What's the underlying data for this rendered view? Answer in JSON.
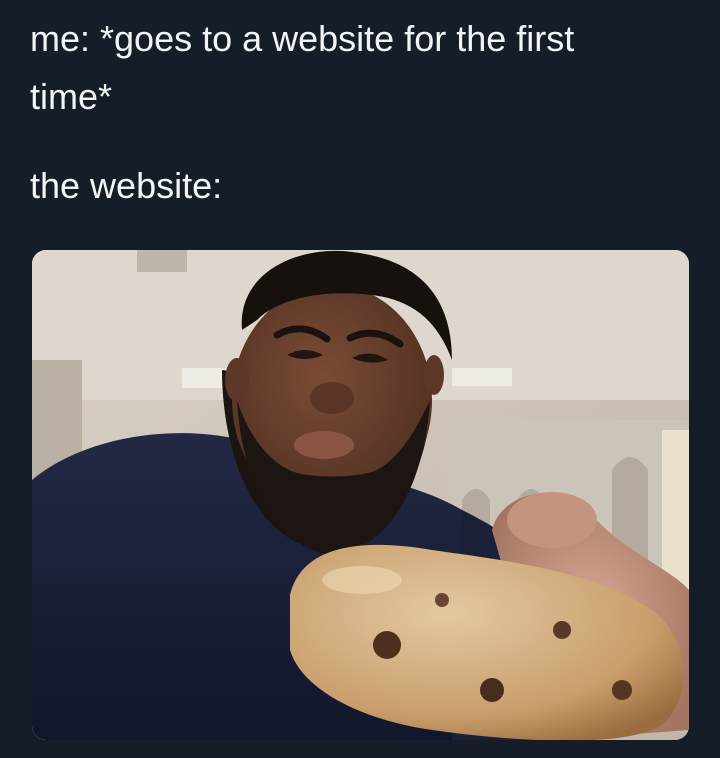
{
  "post": {
    "caption_line_1": "me: *goes to a website for the first",
    "caption_line_2": "time*",
    "caption_line_3": "the website:"
  },
  "image": {
    "subject": "man holding a cookie toward the camera"
  },
  "colors": {
    "background": "#151e28",
    "text": "#f2f4f6"
  }
}
